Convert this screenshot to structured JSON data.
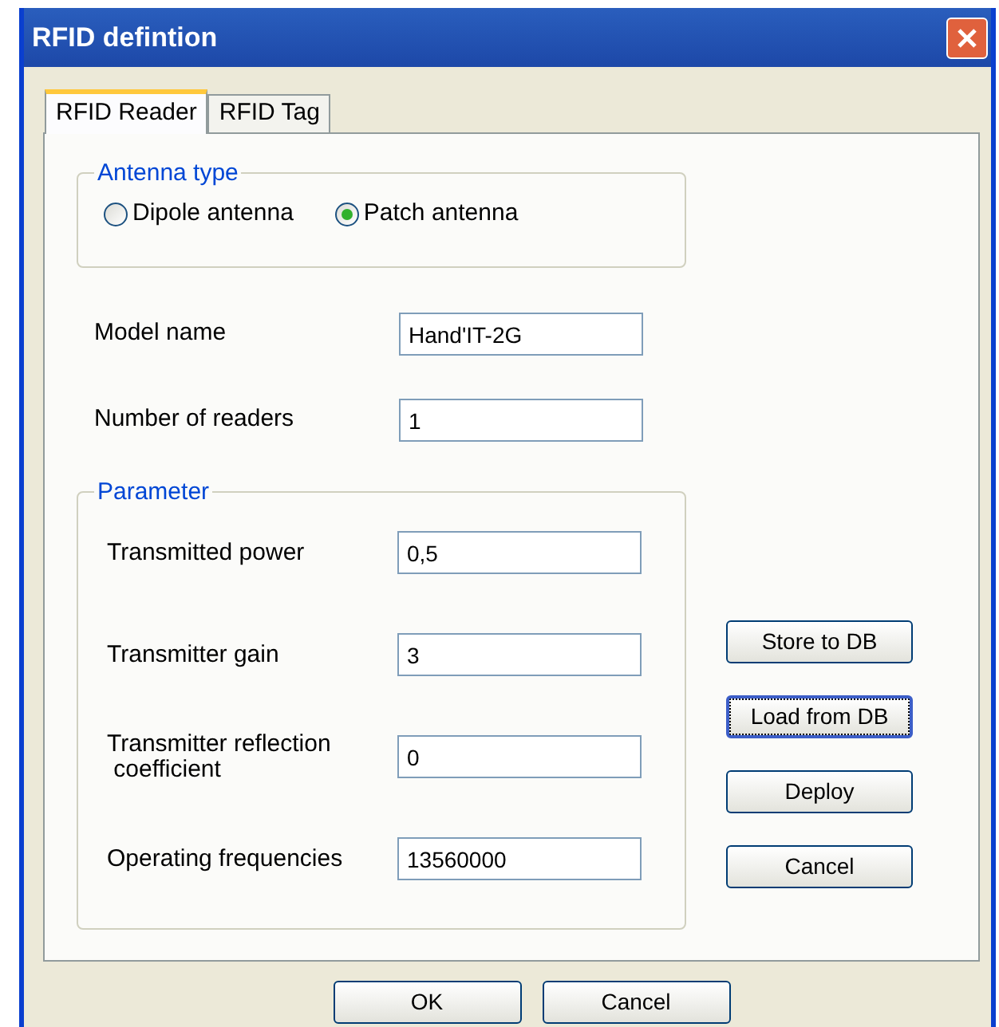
{
  "window": {
    "title": "RFID defintion"
  },
  "tabs": [
    {
      "label": "RFID Reader",
      "selected": true
    },
    {
      "label": "RFID Tag",
      "selected": false
    }
  ],
  "antenna_type": {
    "title": "Antenna type",
    "options": [
      {
        "label": "Dipole antenna",
        "selected": false
      },
      {
        "label": "Patch antenna",
        "selected": true
      }
    ]
  },
  "fields": [
    {
      "label": "Model name",
      "value": "Hand'IT-2G"
    },
    {
      "label": "Number of readers",
      "value": "1"
    }
  ],
  "parameter": {
    "title": "Parameter",
    "fields": [
      {
        "label": "Transmitted power",
        "value": "0,5"
      },
      {
        "label": "Transmitter gain",
        "value": "3"
      },
      {
        "label": "Transmitter reflection\n coefficient",
        "value": "0"
      },
      {
        "label": "Operating frequencies",
        "value": "13560000"
      }
    ]
  },
  "side_buttons": [
    {
      "label": "Store to DB",
      "focused": false
    },
    {
      "label": "Load from DB",
      "focused": true
    },
    {
      "label": "Deploy",
      "focused": false
    },
    {
      "label": "Cancel",
      "focused": false
    }
  ],
  "buttons": [
    {
      "label": "OK"
    },
    {
      "label": "Cancel"
    }
  ]
}
